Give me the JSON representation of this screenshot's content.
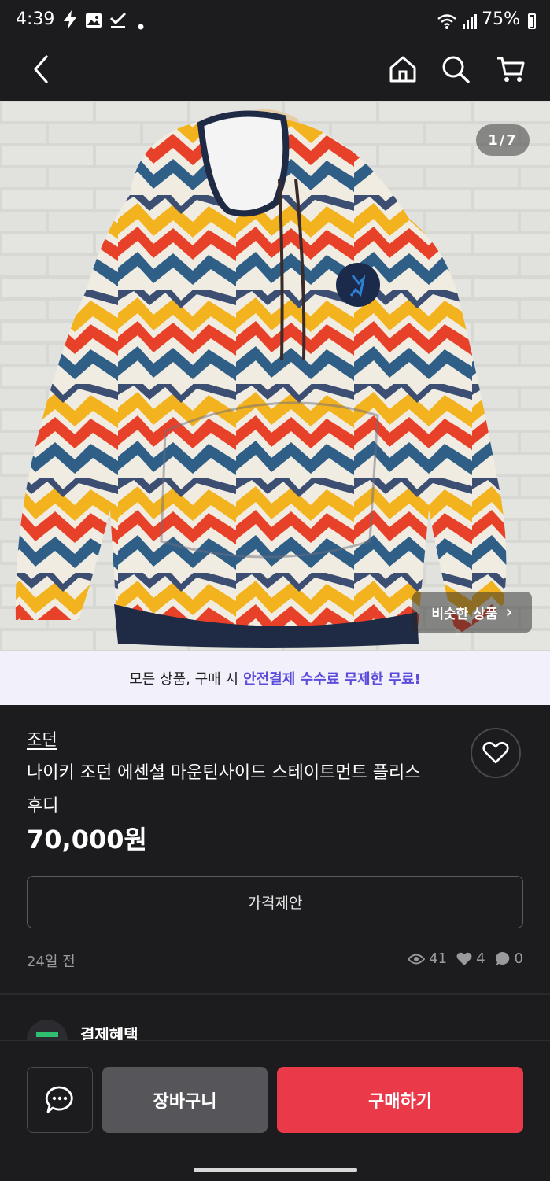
{
  "status_bar": {
    "time": "4:39",
    "battery": "75%",
    "icons": [
      "bolt-icon",
      "image-icon",
      "check-icon",
      "dot-icon",
      "wifi-icon",
      "signal-icon",
      "battery-icon"
    ]
  },
  "nav": {
    "icons": [
      "back-icon",
      "home-icon",
      "search-icon",
      "cart-icon"
    ]
  },
  "image": {
    "counter": "1/7",
    "similar_label": "비슷한 상품",
    "similar_chevron": "›"
  },
  "banner": {
    "prefix": "모든 상품, 구매 시",
    "highlight": "안전결제 수수료 무제한 무료!",
    "highlight_color": "#5b4bdb"
  },
  "product": {
    "brand": "조던",
    "title": "나이키 조던 에센셜 마운틴사이드 스테이트먼트 플리스후디",
    "price": "70,000원",
    "offer_label": "가격제안",
    "posted": "24일 전",
    "stats": {
      "views": "41",
      "likes": "4",
      "chats": "0"
    }
  },
  "benefit": {
    "label": "결제혜택"
  },
  "bottom": {
    "cart_label": "장바구니",
    "buy_label": "구매하기",
    "buy_color": "#ea3a4a",
    "cart_color": "#56565a"
  }
}
